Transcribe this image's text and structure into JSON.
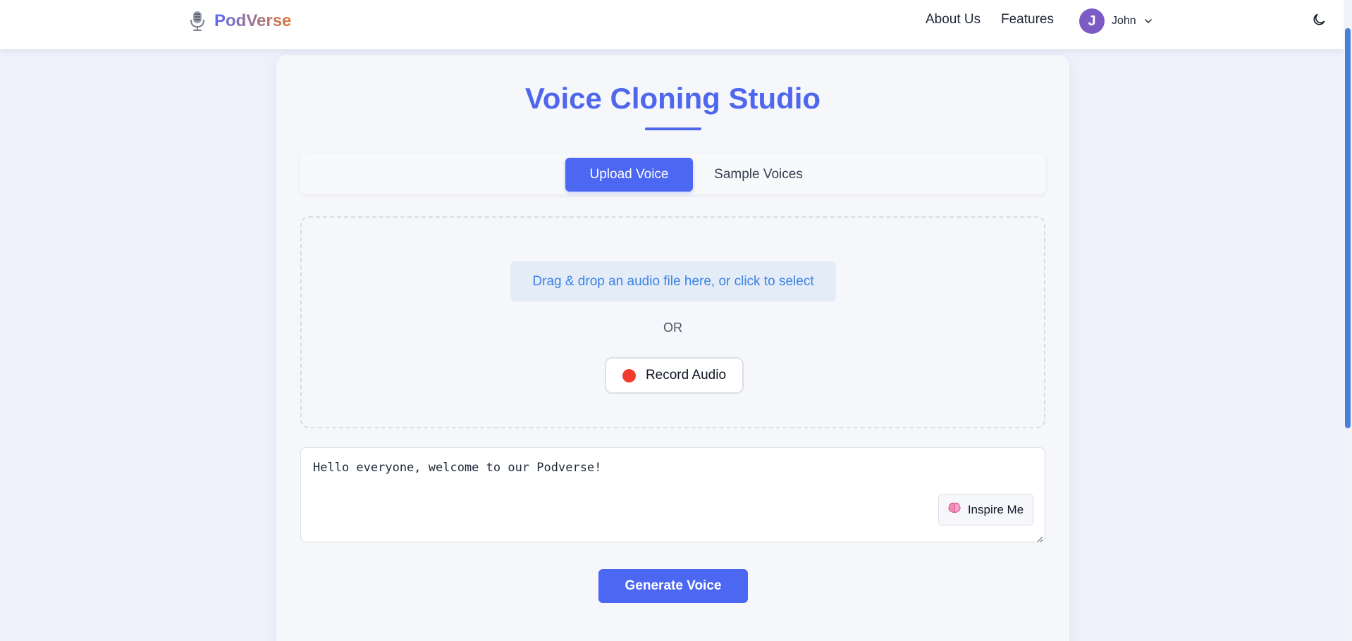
{
  "header": {
    "brand": "PodVerse",
    "nav": {
      "about": "About Us",
      "features": "Features"
    },
    "user": {
      "initial": "J",
      "name": "John"
    },
    "icons": {
      "logo": "microphone-icon",
      "user_menu": "chevron-down-icon",
      "theme": "moon-icon"
    }
  },
  "main": {
    "title": "Voice Cloning Studio",
    "tabs": [
      {
        "label": "Upload Voice",
        "active": true
      },
      {
        "label": "Sample Voices",
        "active": false
      }
    ],
    "upload": {
      "drop_label": "Drag & drop an audio file here, or click to select",
      "or_label": "OR",
      "record_label": "Record Audio"
    },
    "text_input": {
      "value": "Hello everyone, welcome to our Podverse!",
      "inspire_label": "Inspire Me"
    },
    "generate_label": "Generate Voice"
  },
  "colors": {
    "accent": "#4c67f2",
    "title": "#4f67ec",
    "record_dot": "#f23a2f",
    "avatar": "#7c5cc4",
    "drop_text": "#3b82e6"
  }
}
